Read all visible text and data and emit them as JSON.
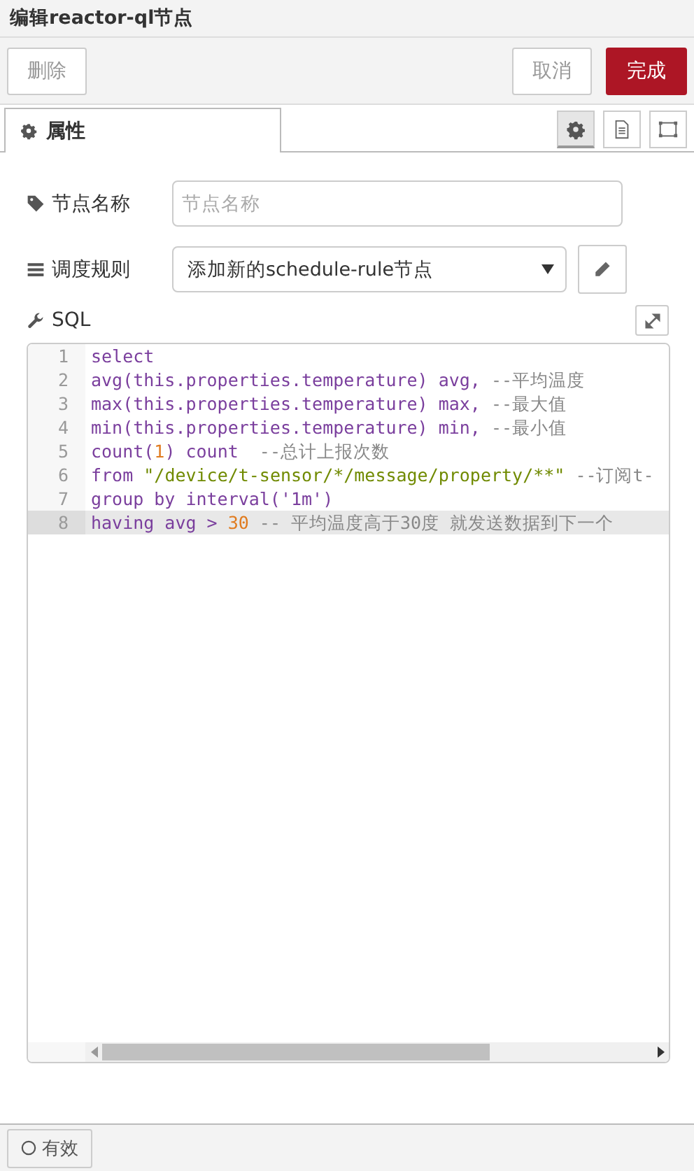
{
  "window": {
    "title": "编辑reactor-ql节点"
  },
  "actions": {
    "delete": "删除",
    "cancel": "取消",
    "done": "完成"
  },
  "tabs": [
    {
      "label": "属性",
      "selected": true
    }
  ],
  "side_tabs": [
    {
      "kind": "gear",
      "selected": true
    },
    {
      "kind": "document",
      "selected": false
    },
    {
      "kind": "frame",
      "selected": false
    }
  ],
  "form": {
    "name_label": "节点名称",
    "name_placeholder": "节点名称",
    "rule_label": "调度规则",
    "rule_value": "添加新的schedule-rule节点",
    "sql_label": "SQL"
  },
  "editor": {
    "lines": [
      {
        "number": "1",
        "active": false,
        "tokens": [
          {
            "kind": "keyword",
            "text": "select"
          }
        ]
      },
      {
        "number": "2",
        "active": false,
        "tokens": [
          {
            "kind": "keyword",
            "text": "avg(this.properties.temperature) avg,"
          },
          {
            "kind": "comment",
            "text": " --平均温度"
          }
        ]
      },
      {
        "number": "3",
        "active": false,
        "tokens": [
          {
            "kind": "keyword",
            "text": "max(this.properties.temperature) max,"
          },
          {
            "kind": "comment",
            "text": " --最大值"
          }
        ]
      },
      {
        "number": "4",
        "active": false,
        "tokens": [
          {
            "kind": "keyword",
            "text": "min(this.properties.temperature) min,"
          },
          {
            "kind": "comment",
            "text": " --最小值"
          }
        ]
      },
      {
        "number": "5",
        "active": false,
        "tokens": [
          {
            "kind": "keyword",
            "text": "count("
          },
          {
            "kind": "number",
            "text": "1"
          },
          {
            "kind": "keyword",
            "text": ") count"
          },
          {
            "kind": "comment",
            "text": "  --总计上报次数"
          }
        ]
      },
      {
        "number": "6",
        "active": false,
        "tokens": [
          {
            "kind": "keyword",
            "text": "from "
          },
          {
            "kind": "string",
            "text": "\"/device/t-sensor/*/message/property/**\""
          },
          {
            "kind": "comment",
            "text": " --订阅t-"
          }
        ]
      },
      {
        "number": "7",
        "active": false,
        "tokens": [
          {
            "kind": "keyword",
            "text": "group by interval('1m')"
          }
        ]
      },
      {
        "number": "8",
        "active": true,
        "tokens": [
          {
            "kind": "keyword",
            "text": "having avg > "
          },
          {
            "kind": "number",
            "text": "30"
          },
          {
            "kind": "comment",
            "text": " -- 平均温度高于30度 就发送数据到下一个"
          }
        ]
      }
    ]
  },
  "footer": {
    "enabled_label": "有效",
    "enabled": false
  }
}
